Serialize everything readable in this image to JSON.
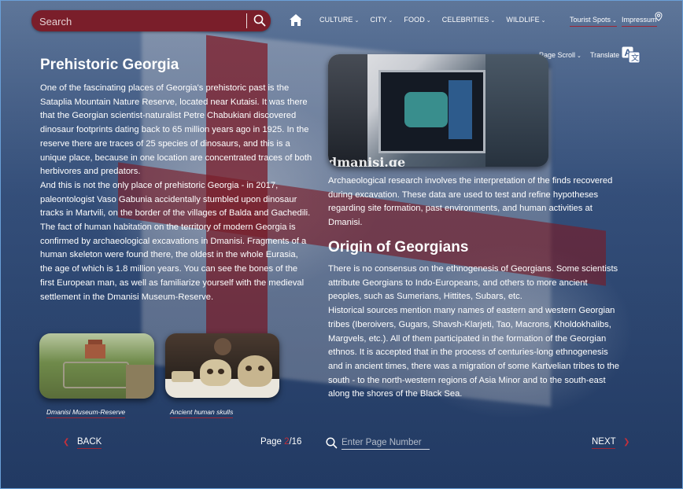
{
  "search": {
    "placeholder": "Search"
  },
  "nav": {
    "items": [
      {
        "label": "CULTURE"
      },
      {
        "label": "CITY"
      },
      {
        "label": "FOOD"
      },
      {
        "label": "CELEBRITIES"
      },
      {
        "label": "WILDLIFE"
      }
    ],
    "tourist_spots": "Tourist Spots",
    "impressum": "Impressum"
  },
  "tools": {
    "page_scroll": "Page  Scroll",
    "translate": "Translate"
  },
  "left": {
    "title": "Prehistoric Georgia",
    "paragraphs": [
      "One of the fascinating places of Georgia's prehistoric past is the Sataplia Mountain Nature Reserve, located near Kutaisi. It was there that the Georgian scientist-naturalist Petre Chabukiani discovered dinosaur footprints dating back to 65 million years ago in 1925. In the reserve there are traces of 25 species of dinosaurs, and this is a unique place, because in one location are concentrated traces of both herbivores and predators.",
      "And this is not the only place of prehistoric Georgia - in 2017, paleontologist Vaso Gabunia accidentally stumbled upon dinosaur tracks in Martvili, on the border of the villages of Balda and Gachedili.",
      "The fact of human habitation on the territory of modern Georgia is confirmed by archaeological excavations in Dmanisi. Fragments of a human skeleton were found there, the oldest in the whole Eurasia, the age of which is 1.8 million years. You can see the bones of the first European man, as well as familiarize yourself with the medieval settlement in the Dmanisi Museum-Reserve."
    ],
    "captions": [
      "Dmanisi Museum-Reserve",
      "Ancient human skulls"
    ]
  },
  "right": {
    "photo_watermark": "dmanisi.ge",
    "paragraph": "Archaeological research involves the interpretation of the finds recovered during excavation. These data are used to test and refine hypotheses regarding site formation, past environments, and human activities at Dmanisi.",
    "title": "Origin of Georgians",
    "paragraphs": [
      "There is no consensus on the ethnogenesis of Georgians. Some scientists attribute Georgians to Indo-Europeans, and others to more ancient peoples, such as Sumerians, Hittites, Subars, etc.",
      "Historical sources mention many names of eastern and western Georgian tribes (Iberoivers, Gugars, Shavsh-Klarjeti, Tao, Macrons, Kholdokhalibs, Margvels, etc.).  All of them participated in the formation of the Georgian ethnos. It is accepted that in the process of centuries-long ethnogenesis and in ancient times, there was a migration of some Kartvelian tribes to the south - to the north-western regions of Asia Minor and to the south-east along the shores of the Black Sea."
    ]
  },
  "pagination": {
    "back": "BACK",
    "next": "NEXT",
    "page_label": "Page ",
    "current": "2",
    "total": "/16",
    "input_placeholder": "Enter Page Number"
  },
  "colors": {
    "accent": "#7a1e2a",
    "accent_text": "#c2303c"
  }
}
